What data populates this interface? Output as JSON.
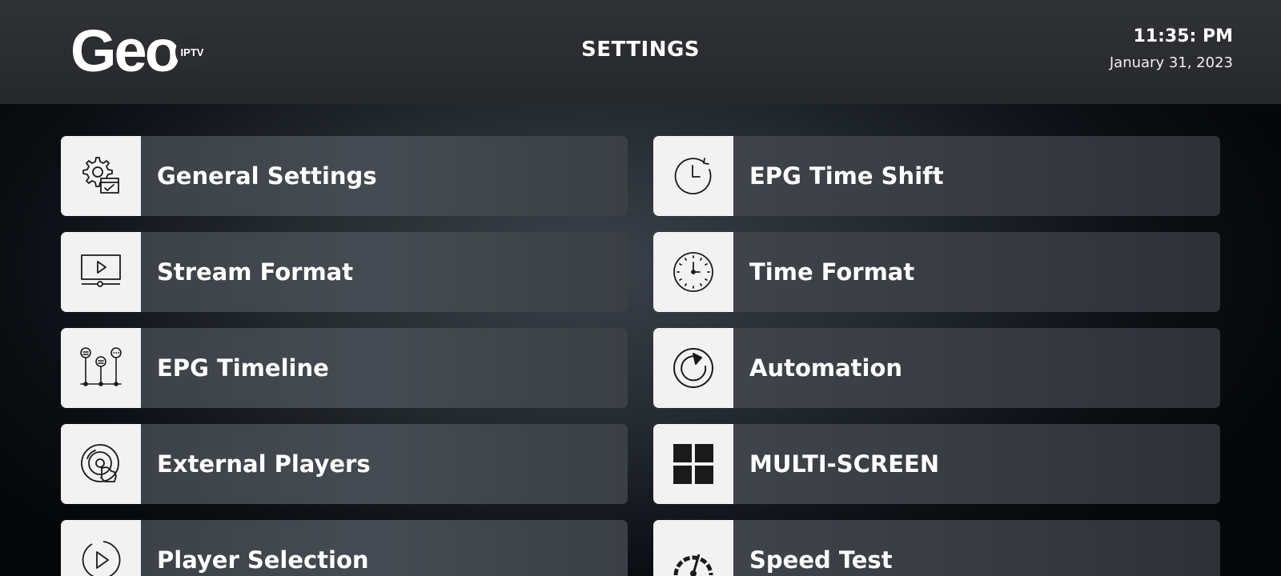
{
  "header": {
    "logo_text": "Geo",
    "logo_badge": "IPTV",
    "title": "SETTINGS",
    "time": "11:35: PM",
    "date": "January  31, 2023"
  },
  "menu": {
    "left": [
      {
        "label": "General Settings",
        "icon": "gear-checklist-icon"
      },
      {
        "label": "Stream Format",
        "icon": "video-player-icon"
      },
      {
        "label": "EPG Timeline",
        "icon": "timeline-icon"
      },
      {
        "label": "External Players",
        "icon": "disc-hand-icon"
      },
      {
        "label": "Player Selection",
        "icon": "play-circle-icon"
      }
    ],
    "right": [
      {
        "label": "EPG Time Shift",
        "icon": "clock-arrow-icon"
      },
      {
        "label": "Time Format",
        "icon": "clock-icon"
      },
      {
        "label": "Automation",
        "icon": "refresh-icon"
      },
      {
        "label": "MULTI-SCREEN",
        "icon": "grid-icon"
      },
      {
        "label": "Speed Test",
        "icon": "speedometer-icon"
      }
    ]
  },
  "colors": {
    "icon_box": "#f2f2f2",
    "icon_stroke": "#1a1a1a",
    "text": "#ffffff"
  }
}
